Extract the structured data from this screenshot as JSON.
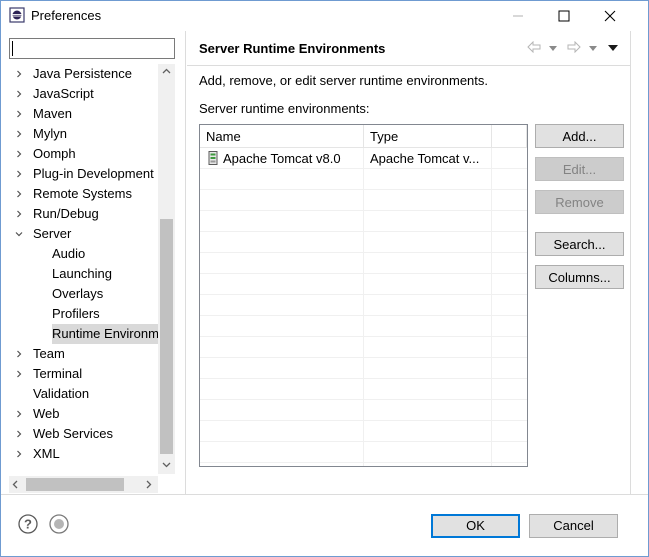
{
  "window": {
    "title": "Preferences"
  },
  "filter": {
    "value": ""
  },
  "tree": {
    "items": [
      {
        "label": "Java Persistence",
        "level": 0,
        "expandable": true,
        "expanded": false,
        "selected": false
      },
      {
        "label": "JavaScript",
        "level": 0,
        "expandable": true,
        "expanded": false,
        "selected": false
      },
      {
        "label": "Maven",
        "level": 0,
        "expandable": true,
        "expanded": false,
        "selected": false
      },
      {
        "label": "Mylyn",
        "level": 0,
        "expandable": true,
        "expanded": false,
        "selected": false
      },
      {
        "label": "Oomph",
        "level": 0,
        "expandable": true,
        "expanded": false,
        "selected": false
      },
      {
        "label": "Plug-in Development",
        "level": 0,
        "expandable": true,
        "expanded": false,
        "selected": false
      },
      {
        "label": "Remote Systems",
        "level": 0,
        "expandable": true,
        "expanded": false,
        "selected": false
      },
      {
        "label": "Run/Debug",
        "level": 0,
        "expandable": true,
        "expanded": false,
        "selected": false
      },
      {
        "label": "Server",
        "level": 0,
        "expandable": true,
        "expanded": true,
        "selected": false
      },
      {
        "label": "Audio",
        "level": 1,
        "expandable": false,
        "expanded": false,
        "selected": false
      },
      {
        "label": "Launching",
        "level": 1,
        "expandable": false,
        "expanded": false,
        "selected": false
      },
      {
        "label": "Overlays",
        "level": 1,
        "expandable": false,
        "expanded": false,
        "selected": false
      },
      {
        "label": "Profilers",
        "level": 1,
        "expandable": false,
        "expanded": false,
        "selected": false
      },
      {
        "label": "Runtime Environme",
        "level": 1,
        "expandable": false,
        "expanded": false,
        "selected": true
      },
      {
        "label": "Team",
        "level": 0,
        "expandable": true,
        "expanded": false,
        "selected": false
      },
      {
        "label": "Terminal",
        "level": 0,
        "expandable": true,
        "expanded": false,
        "selected": false
      },
      {
        "label": "Validation",
        "level": 0,
        "expandable": false,
        "expanded": false,
        "selected": false
      },
      {
        "label": "Web",
        "level": 0,
        "expandable": true,
        "expanded": false,
        "selected": false
      },
      {
        "label": "Web Services",
        "level": 0,
        "expandable": true,
        "expanded": false,
        "selected": false
      },
      {
        "label": "XML",
        "level": 0,
        "expandable": true,
        "expanded": false,
        "selected": false
      }
    ]
  },
  "page": {
    "title": "Server Runtime Environments",
    "description": "Add, remove, or edit server runtime environments.",
    "table_label": "Server runtime environments:",
    "nav_icons": [
      "back-arrow-icon",
      "back-dropdown-icon",
      "forward-arrow-icon",
      "forward-dropdown-icon",
      "view-menu-icon"
    ]
  },
  "table": {
    "columns": [
      "Name",
      "Type"
    ],
    "rows": [
      {
        "name": "Apache Tomcat v8.0",
        "type": "Apache Tomcat v...",
        "icon": "server-icon"
      }
    ]
  },
  "buttons": {
    "add": "Add...",
    "edit": "Edit...",
    "remove": "Remove",
    "search": "Search...",
    "columns": "Columns...",
    "ok": "OK",
    "cancel": "Cancel"
  },
  "colors": {
    "accent": "#0078d7",
    "selection": "#d9d9d9"
  }
}
